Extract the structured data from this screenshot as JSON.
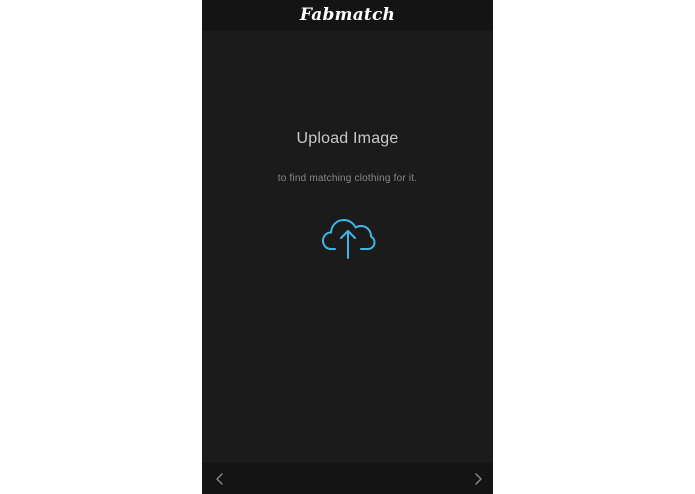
{
  "app": {
    "brand": "Fabmatch"
  },
  "upload": {
    "title": "Upload Image",
    "subtitle": "to find matching clothing for it.",
    "icon": "cloud-upload-icon",
    "accent_color": "#3fb6e6"
  },
  "nav": {
    "prev_icon": "chevron-left-icon",
    "next_icon": "chevron-right-icon"
  }
}
